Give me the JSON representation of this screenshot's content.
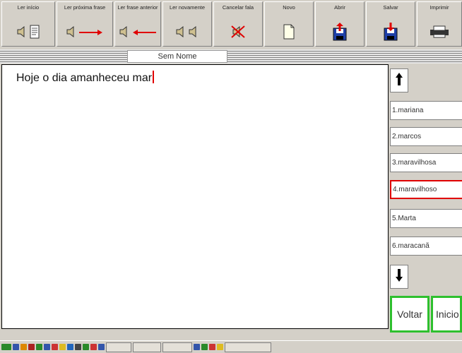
{
  "toolbar": {
    "buttons": [
      {
        "label": "Ler início",
        "icons": [
          "speaker-icon",
          "document-icon"
        ]
      },
      {
        "label": "Ler próxima frase",
        "icons": [
          "speaker-icon",
          "arrow-right-icon"
        ]
      },
      {
        "label": "Ler frase anterior",
        "icons": [
          "speaker-icon",
          "arrow-left-icon"
        ]
      },
      {
        "label": "Ler novamente",
        "icons": [
          "speaker-icon",
          "speaker-icon"
        ]
      },
      {
        "label": "Cancelar fala",
        "icons": [
          "cancel-speech-icon"
        ]
      },
      {
        "label": "Novo",
        "icons": [
          "new-document-icon"
        ]
      },
      {
        "label": "Abrir",
        "icons": [
          "open-floppy-icon"
        ]
      },
      {
        "label": "Salvar",
        "icons": [
          "save-floppy-icon"
        ]
      },
      {
        "label": "Imprimir",
        "icons": [
          "printer-icon"
        ]
      }
    ]
  },
  "document": {
    "title": "Sem Nome",
    "text": "Hoje o dia amanheceu mar"
  },
  "sidebar": {
    "up_icon": "arrow-up-icon",
    "down_icon": "arrow-down-icon",
    "suggestions": [
      "1.mariana",
      "2.marcos",
      "3.maravilhosa",
      "4.maravilhoso",
      "5.Marta",
      "6.maracanã"
    ],
    "selected_index": 3,
    "voltar_label": "Voltar",
    "inicio_label": "Inicio"
  },
  "colors": {
    "accent_red": "#e00000",
    "nav_green": "#2ec02e",
    "floppy_blue": "#1e3fa8"
  }
}
